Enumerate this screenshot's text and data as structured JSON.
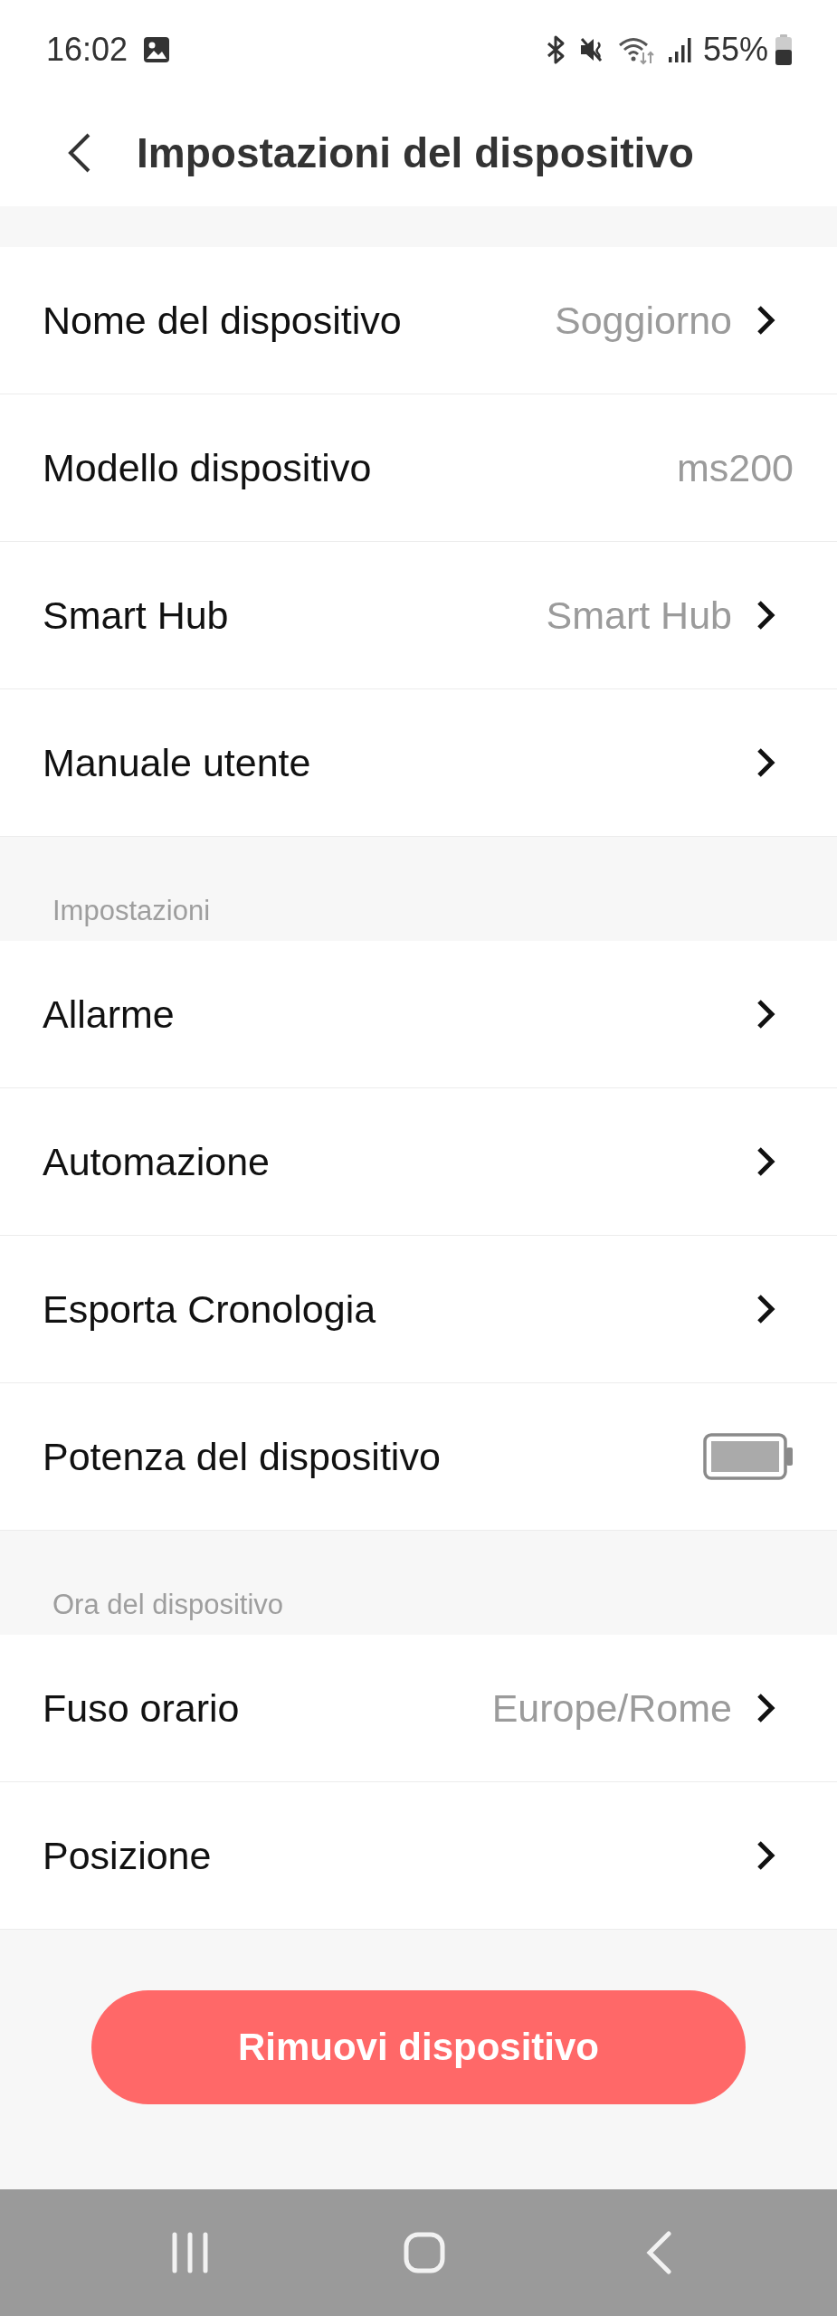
{
  "status_bar": {
    "time": "16:02",
    "battery": "55%"
  },
  "header": {
    "title": "Impostazioni del dispositivo"
  },
  "sections": [
    {
      "rows": [
        {
          "kind": "link",
          "label": "Nome del dispositivo",
          "value": "Soggiorno"
        },
        {
          "kind": "info",
          "label": "Modello dispositivo",
          "value": "ms200"
        },
        {
          "kind": "link",
          "label": "Smart Hub",
          "value": "Smart Hub"
        },
        {
          "kind": "link",
          "label": "Manuale utente"
        }
      ]
    },
    {
      "title": "Impostazioni",
      "rows": [
        {
          "kind": "link",
          "label": "Allarme"
        },
        {
          "kind": "link",
          "label": "Automazione"
        },
        {
          "kind": "link",
          "label": "Esporta Cronologia"
        },
        {
          "kind": "battery",
          "label": "Potenza del dispositivo"
        }
      ]
    },
    {
      "title": "Ora del dispositivo",
      "rows": [
        {
          "kind": "link",
          "label": "Fuso orario",
          "value": "Europe/Rome"
        },
        {
          "kind": "link",
          "label": "Posizione"
        }
      ]
    }
  ],
  "remove_button": {
    "label": "Rimuovi dispositivo"
  }
}
